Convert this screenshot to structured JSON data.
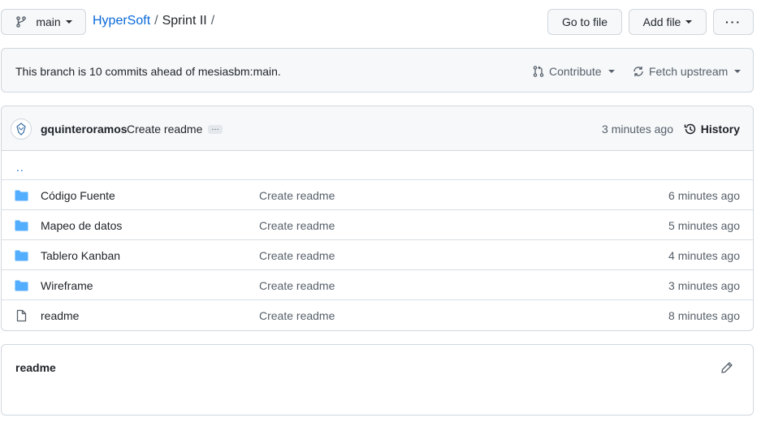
{
  "header": {
    "branch_label": "main",
    "repo_link": "HyperSoft",
    "separator": "/",
    "path_segment": "Sprint II",
    "trailing_separator": "/",
    "go_to_file_label": "Go to file",
    "add_file_label": "Add file",
    "more_label": "···"
  },
  "branch_status": {
    "message": "This branch is 10 commits ahead of mesiasbm:main.",
    "contribute_label": "Contribute",
    "fetch_label": "Fetch upstream"
  },
  "latest_commit": {
    "author": "gquinteroramos",
    "message": "Create readme",
    "ellipsis": "…",
    "time": "3 minutes ago",
    "history_label": "History"
  },
  "files": {
    "parent_dir": "..",
    "rows": [
      {
        "type": "folder",
        "name": "Código Fuente",
        "commit": "Create readme",
        "age": "6 minutes ago"
      },
      {
        "type": "folder",
        "name": "Mapeo de datos",
        "commit": "Create readme",
        "age": "5 minutes ago"
      },
      {
        "type": "folder",
        "name": "Tablero Kanban",
        "commit": "Create readme",
        "age": "4 minutes ago"
      },
      {
        "type": "folder",
        "name": "Wireframe",
        "commit": "Create readme",
        "age": "3 minutes ago"
      },
      {
        "type": "file",
        "name": "readme",
        "commit": "Create readme",
        "age": "8 minutes ago"
      }
    ]
  },
  "readme": {
    "title": "readme"
  },
  "colors": {
    "link": "#0969da",
    "folder": "#54aeff",
    "muted": "#57606a",
    "border": "#d0d7de",
    "subtle_bg": "#f6f8fa"
  }
}
